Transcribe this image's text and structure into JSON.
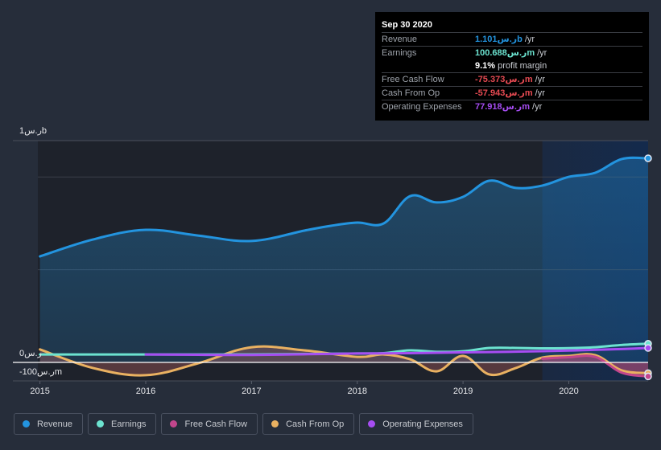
{
  "tooltip": {
    "date": "Sep 30 2020",
    "rows": [
      {
        "label": "Revenue",
        "value": "1.101ر.سb",
        "unit": "/yr",
        "color": "#2394df"
      },
      {
        "label": "Earnings",
        "value": "100.688ر.سm",
        "unit": "/yr",
        "color": "#6ce3d0"
      },
      {
        "label": "",
        "value": "9.1%",
        "unit": "profit margin",
        "color": "#ffffff"
      },
      {
        "label": "Free Cash Flow",
        "value": "-75.373ر.سm",
        "unit": "/yr",
        "color": "#e64a52"
      },
      {
        "label": "Cash From Op",
        "value": "-57.943ر.سm",
        "unit": "/yr",
        "color": "#e64a52"
      },
      {
        "label": "Operating Expenses",
        "value": "77.918ر.سm",
        "unit": "/yr",
        "color": "#a64df2"
      }
    ]
  },
  "legend": [
    {
      "label": "Revenue",
      "color": "#2394df"
    },
    {
      "label": "Earnings",
      "color": "#6ce3d0"
    },
    {
      "label": "Free Cash Flow",
      "color": "#c2468c"
    },
    {
      "label": "Cash From Op",
      "color": "#e9b161"
    },
    {
      "label": "Operating Expenses",
      "color": "#a64df2"
    }
  ],
  "chart_data": {
    "type": "line",
    "title": "",
    "xlabel": "",
    "ylabel": "",
    "currency": "ر.س",
    "y_tick_labels": {
      "top": "1ر.سb",
      "zero": "0ر.س",
      "bottom": "-100ر.سm"
    },
    "ylim": [
      -100,
      1200
    ],
    "x_ticks": [
      "2015",
      "2016",
      "2017",
      "2018",
      "2019",
      "2020"
    ],
    "xlim": [
      2014.98,
      2020.75
    ],
    "highlight_start": 2019.75,
    "grid": true,
    "legend_position": "bottom",
    "units": "millions",
    "series": [
      {
        "name": "Revenue",
        "color": "#2394df",
        "area": true,
        "x": [
          2015.0,
          2015.5,
          2016.0,
          2016.5,
          2017.0,
          2017.5,
          2017.75,
          2018.0,
          2018.25,
          2018.5,
          2018.75,
          2019.0,
          2019.25,
          2019.5,
          2019.75,
          2020.0,
          2020.25,
          2020.5,
          2020.75
        ],
        "values": [
          572,
          663,
          715,
          684,
          655,
          711,
          737,
          754,
          750,
          897,
          863,
          893,
          980,
          941,
          954,
          1001,
          1023,
          1097,
          1101
        ]
      },
      {
        "name": "Earnings",
        "color": "#6ce3d0",
        "area": false,
        "x": [
          2015.0,
          2016.0,
          2017.0,
          2018.0,
          2018.25,
          2018.5,
          2018.75,
          2019.0,
          2019.25,
          2019.5,
          2019.75,
          2020.0,
          2020.25,
          2020.5,
          2020.75
        ],
        "values": [
          43,
          43,
          43,
          48,
          50,
          65,
          57,
          60,
          78,
          78,
          76,
          77,
          82,
          94,
          100.7
        ]
      },
      {
        "name": "Operating Expenses",
        "color": "#a64df2",
        "area": false,
        "x": [
          2016.0,
          2016.5,
          2017.0,
          2017.5,
          2018.0,
          2018.5,
          2019.0,
          2019.5,
          2020.0,
          2020.5,
          2020.75
        ],
        "values": [
          43,
          41,
          40,
          44,
          48,
          50,
          54,
          58,
          64,
          72,
          77.9
        ]
      },
      {
        "name": "Cash From Op",
        "color": "#e9b161",
        "area": true,
        "x": [
          2015.0,
          2015.5,
          2016.0,
          2016.5,
          2017.0,
          2017.5,
          2018.0,
          2018.25,
          2018.5,
          2018.75,
          2019.0,
          2019.25,
          2019.5,
          2019.75,
          2020.0,
          2020.25,
          2020.5,
          2020.75
        ],
        "values": [
          70,
          -30,
          -69,
          -4,
          82,
          65,
          30,
          43,
          17,
          -48,
          35,
          -65,
          -30,
          26,
          35,
          39,
          -43,
          -57.9
        ]
      },
      {
        "name": "Free Cash Flow",
        "color": "#c2468c",
        "area": true,
        "x": [
          2019.75,
          2020.0,
          2020.25,
          2020.5,
          2020.75
        ],
        "values": [
          20,
          28,
          30,
          -55,
          -75.4
        ]
      }
    ]
  }
}
